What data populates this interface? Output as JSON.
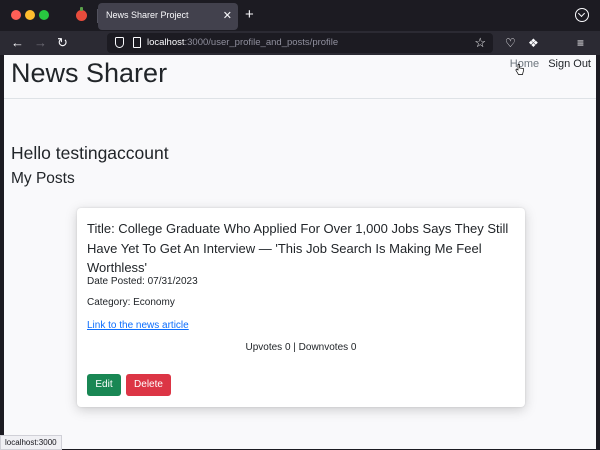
{
  "browser": {
    "tab_title": "News Sharer Project",
    "tab_close": "✕",
    "new_tab": "+",
    "url_host": "localhost",
    "url_rest": ":3000/user_profile_and_posts/profile",
    "status_url": "localhost:3000"
  },
  "site": {
    "brand": "News Sharer",
    "nav_home": "Home",
    "nav_signout": "Sign Out"
  },
  "profile": {
    "greeting": "Hello testingaccount",
    "section_title": "My Posts"
  },
  "post": {
    "title": "Title: College Graduate Who Applied For Over 1,000 Jobs Says They Still Have Yet To Get An Interview — 'This Job Search Is Making Me Feel Worthless'",
    "date": "Date Posted: 07/31/2023",
    "category": "Category: Economy",
    "link_text": "Link to the news article",
    "votes": "Upvotes 0 | Downvotes 0",
    "edit_label": "Edit",
    "delete_label": "Delete"
  },
  "colors": {
    "edit_button": "#198754",
    "delete_button": "#dc3545",
    "link": "#0d6efd"
  }
}
